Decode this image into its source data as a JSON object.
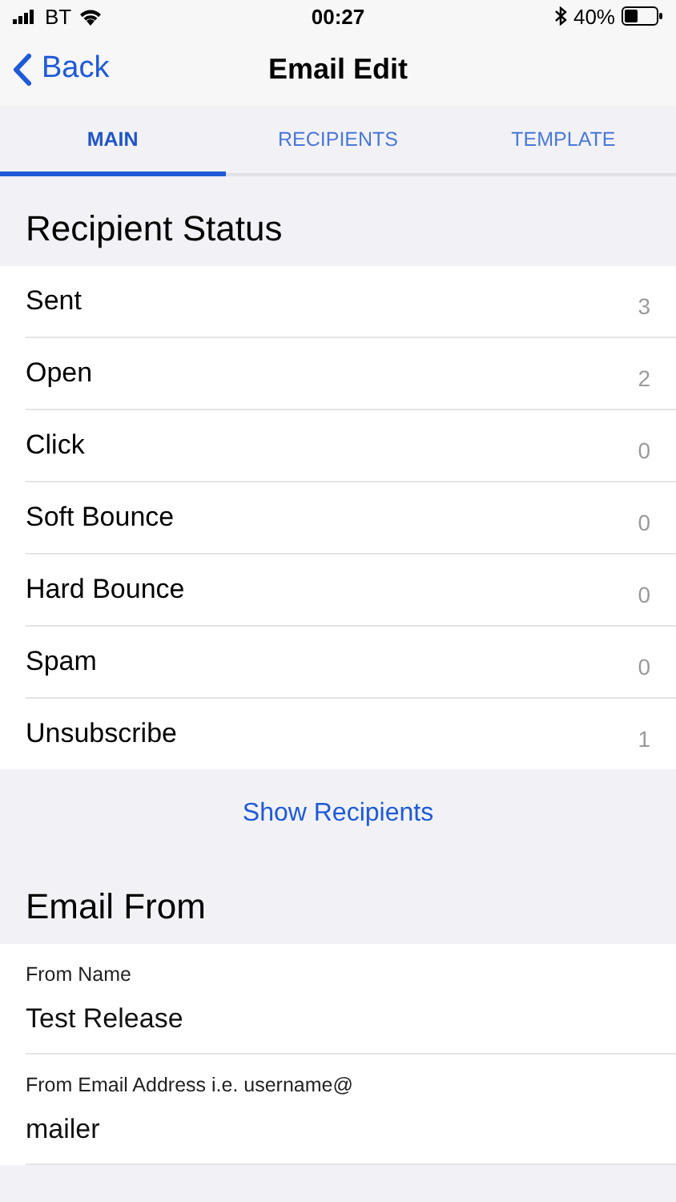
{
  "status_bar": {
    "carrier": "BT",
    "time": "00:27",
    "battery": "40%"
  },
  "nav": {
    "back": "Back",
    "title": "Email Edit"
  },
  "tabs": [
    {
      "label": "MAIN",
      "selected": true
    },
    {
      "label": "RECIPIENTS",
      "selected": false
    },
    {
      "label": "TEMPLATE",
      "selected": false
    }
  ],
  "recipient_status": {
    "title": "Recipient Status",
    "rows": [
      {
        "label": "Sent",
        "count": "3"
      },
      {
        "label": "Open",
        "count": "2"
      },
      {
        "label": "Click",
        "count": "0"
      },
      {
        "label": "Soft Bounce",
        "count": "0"
      },
      {
        "label": "Hard Bounce",
        "count": "0"
      },
      {
        "label": "Spam",
        "count": "0"
      },
      {
        "label": "Unsubscribe",
        "count": "1"
      }
    ],
    "action": "Show Recipients"
  },
  "email_from": {
    "title": "Email From",
    "fields": [
      {
        "label": "From Name",
        "value": "Test Release"
      },
      {
        "label": "From Email Address i.e. username@",
        "value": "mailer"
      }
    ]
  }
}
